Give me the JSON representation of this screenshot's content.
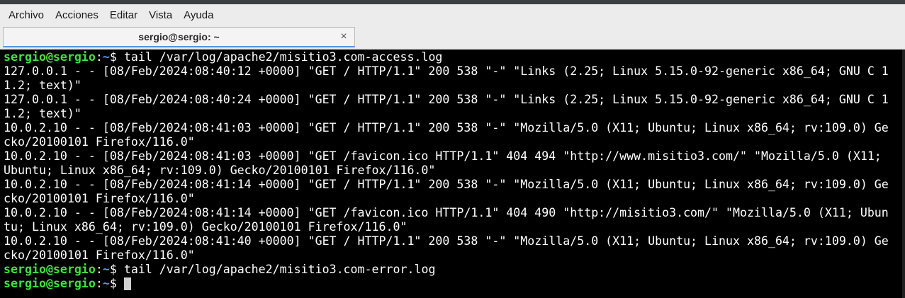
{
  "menubar": {
    "items": [
      "Archivo",
      "Acciones",
      "Editar",
      "Vista",
      "Ayuda"
    ]
  },
  "tab": {
    "title": "sergio@sergio: ~",
    "close_icon": "×"
  },
  "prompt": {
    "user_host": "sergio@sergio",
    "sep": ":",
    "path": "~",
    "symbol": "$ "
  },
  "terminal": {
    "command1": "tail /var/log/apache2/misitio3.com-access.log",
    "output_lines": [
      "127.0.0.1 - - [08/Feb/2024:08:40:12 +0000] \"GET / HTTP/1.1\" 200 538 \"-\" \"Links (2.25; Linux 5.15.0-92-generic x86_64; GNU C 1",
      "1.2; text)\"",
      "127.0.0.1 - - [08/Feb/2024:08:40:24 +0000] \"GET / HTTP/1.1\" 200 538 \"-\" \"Links (2.25; Linux 5.15.0-92-generic x86_64; GNU C 1",
      "1.2; text)\"",
      "10.0.2.10 - - [08/Feb/2024:08:41:03 +0000] \"GET / HTTP/1.1\" 200 538 \"-\" \"Mozilla/5.0 (X11; Ubuntu; Linux x86_64; rv:109.0) Ge",
      "cko/20100101 Firefox/116.0\"",
      "10.0.2.10 - - [08/Feb/2024:08:41:03 +0000] \"GET /favicon.ico HTTP/1.1\" 404 494 \"http://www.misitio3.com/\" \"Mozilla/5.0 (X11;",
      "Ubuntu; Linux x86_64; rv:109.0) Gecko/20100101 Firefox/116.0\"",
      "10.0.2.10 - - [08/Feb/2024:08:41:14 +0000] \"GET / HTTP/1.1\" 200 538 \"-\" \"Mozilla/5.0 (X11; Ubuntu; Linux x86_64; rv:109.0) Ge",
      "cko/20100101 Firefox/116.0\"",
      "10.0.2.10 - - [08/Feb/2024:08:41:14 +0000] \"GET /favicon.ico HTTP/1.1\" 404 490 \"http://misitio3.com/\" \"Mozilla/5.0 (X11; Ubun",
      "tu; Linux x86_64; rv:109.0) Gecko/20100101 Firefox/116.0\"",
      "10.0.2.10 - - [08/Feb/2024:08:41:40 +0000] \"GET / HTTP/1.1\" 200 538 \"-\" \"Mozilla/5.0 (X11; Ubuntu; Linux x86_64; rv:109.0) Ge",
      "cko/20100101 Firefox/116.0\""
    ],
    "command2": "tail /var/log/apache2/misitio3.com-error.log"
  },
  "colors": {
    "prompt_user": "#3fe33f",
    "prompt_path": "#5c93ff",
    "text": "#ffffff",
    "background": "#000000",
    "tab_accent": "#5294e2"
  }
}
